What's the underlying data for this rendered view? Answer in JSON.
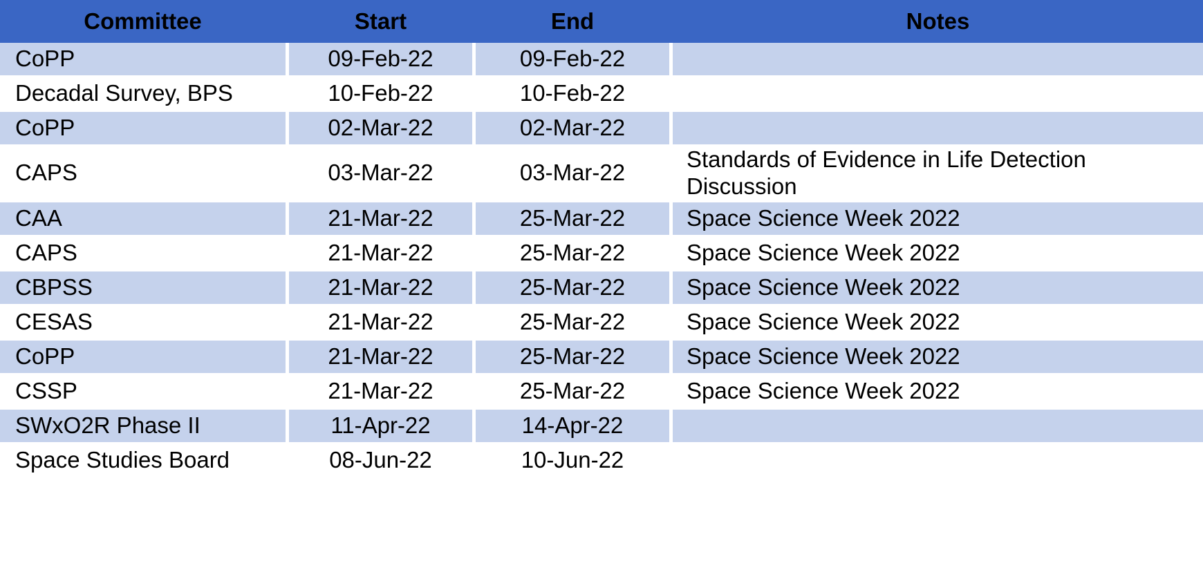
{
  "table": {
    "columns": [
      {
        "key": "committee",
        "label": "Committee"
      },
      {
        "key": "start",
        "label": "Start"
      },
      {
        "key": "end",
        "label": "End"
      },
      {
        "key": "notes",
        "label": "Notes"
      }
    ],
    "header_background": "#3A66C4",
    "shaded_row_background": "#C5D2EC",
    "unshaded_row_background": "#FFFFFF",
    "rows": [
      {
        "committee": "CoPP",
        "start": "09-Feb-22",
        "end": "09-Feb-22",
        "notes": "",
        "shaded": true
      },
      {
        "committee": "Decadal Survey, BPS",
        "start": "10-Feb-22",
        "end": "10-Feb-22",
        "notes": "",
        "shaded": false
      },
      {
        "committee": "CoPP",
        "start": "02-Mar-22",
        "end": "02-Mar-22",
        "notes": "",
        "shaded": true
      },
      {
        "committee": "CAPS",
        "start": "03-Mar-22",
        "end": "03-Mar-22",
        "notes": "Standards of Evidence in Life Detection Discussion",
        "shaded": false
      },
      {
        "committee": "CAA",
        "start": "21-Mar-22",
        "end": "25-Mar-22",
        "notes": "Space Science Week 2022",
        "shaded": true
      },
      {
        "committee": "CAPS",
        "start": "21-Mar-22",
        "end": "25-Mar-22",
        "notes": "Space Science Week 2022",
        "shaded": false
      },
      {
        "committee": "CBPSS",
        "start": "21-Mar-22",
        "end": "25-Mar-22",
        "notes": "Space Science Week 2022",
        "shaded": true
      },
      {
        "committee": "CESAS",
        "start": "21-Mar-22",
        "end": "25-Mar-22",
        "notes": "Space Science Week 2022",
        "shaded": false
      },
      {
        "committee": "CoPP",
        "start": "21-Mar-22",
        "end": "25-Mar-22",
        "notes": "Space Science Week 2022",
        "shaded": true
      },
      {
        "committee": "CSSP",
        "start": "21-Mar-22",
        "end": "25-Mar-22",
        "notes": "Space Science Week 2022",
        "shaded": false
      },
      {
        "committee": "SWxO2R Phase II",
        "start": "11-Apr-22",
        "end": "14-Apr-22",
        "notes": "",
        "shaded": true
      },
      {
        "committee": "Space Studies Board",
        "start": "08-Jun-22",
        "end": "10-Jun-22",
        "notes": "",
        "shaded": false
      }
    ]
  }
}
